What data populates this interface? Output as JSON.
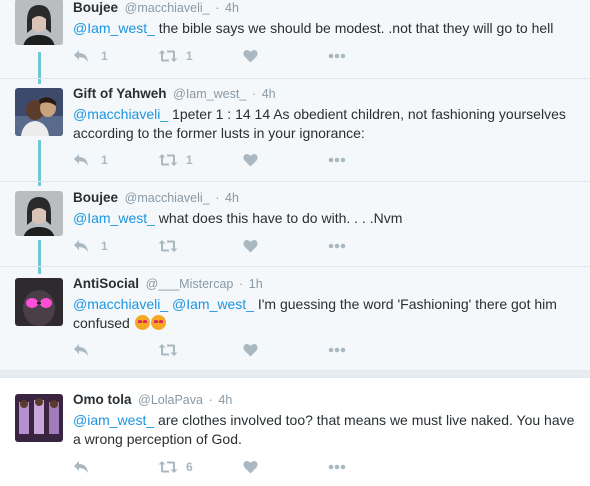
{
  "tweets": [
    {
      "name": "Boujee",
      "handle": "@macchiaveli_",
      "time": "4h",
      "segments": [
        {
          "type": "mention",
          "text": "@Iam_west_"
        },
        {
          "type": "text",
          "text": " the bible says we should be modest. .not that they will go to hell"
        }
      ],
      "replies": "1",
      "retweets": "1",
      "likes": ""
    },
    {
      "name": "Gift of Yahweh",
      "handle": "@Iam_west_",
      "time": "4h",
      "segments": [
        {
          "type": "mention",
          "text": "@macchiaveli_"
        },
        {
          "type": "text",
          "text": " 1peter 1 : 14 14 As obedient children, not fashioning yourselves according to the former lusts in your ignorance:"
        }
      ],
      "replies": "1",
      "retweets": "1",
      "likes": ""
    },
    {
      "name": "Boujee",
      "handle": "@macchiaveli_",
      "time": "4h",
      "segments": [
        {
          "type": "mention",
          "text": "@Iam_west_"
        },
        {
          "type": "text",
          "text": " what does this have to do with. . . .Nvm"
        }
      ],
      "replies": "1",
      "retweets": "",
      "likes": ""
    },
    {
      "name": "AntiSocial",
      "handle": "@___Mistercap",
      "time": "1h",
      "segments": [
        {
          "type": "mention",
          "text": "@macchiaveli_"
        },
        {
          "type": "text",
          "text": " "
        },
        {
          "type": "mention",
          "text": "@Iam_west_"
        },
        {
          "type": "text",
          "text": " I'm guessing the word 'Fashioning' there got him confused "
        },
        {
          "type": "emoji",
          "text": "smiling-blush-emoji"
        },
        {
          "type": "emoji",
          "text": "smiling-blush-emoji"
        }
      ],
      "replies": "",
      "retweets": "",
      "likes": ""
    },
    {
      "name": "Omo tola",
      "handle": "@LolaPava",
      "time": "4h",
      "segments": [
        {
          "type": "mention",
          "text": "@iam_west_"
        },
        {
          "type": "text",
          "text": " are clothes involved too? that means we must live naked. You have a wrong perception of God."
        }
      ],
      "replies": "",
      "retweets": "6",
      "likes": ""
    }
  ],
  "icons": {
    "reply": "reply-icon",
    "retweet": "retweet-icon",
    "like": "heart-icon",
    "more": "more-icon"
  },
  "colors": {
    "link": "#1b95e0",
    "meta": "#8899a6",
    "action": "#aab8c2",
    "thread_line": "#6dc6d4",
    "thread_bg": "#f5f8fa"
  },
  "separator": "·"
}
